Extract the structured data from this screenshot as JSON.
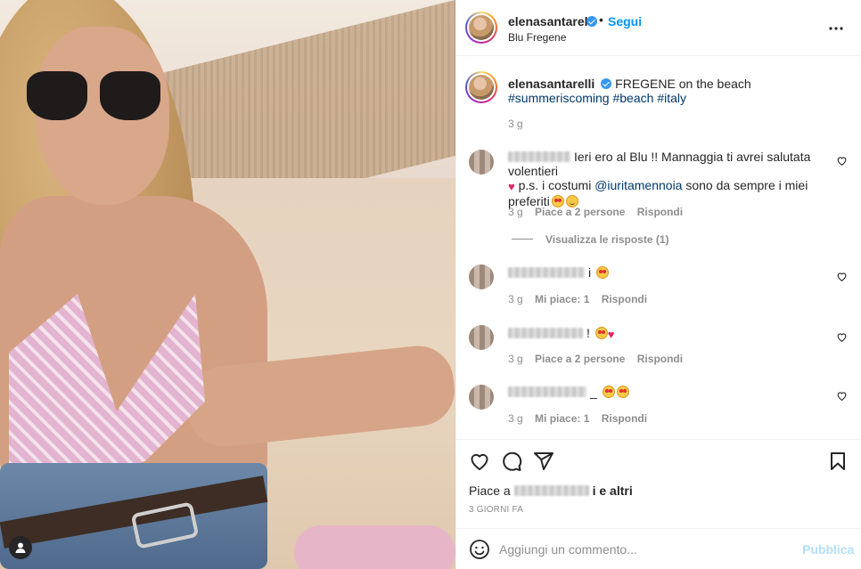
{
  "post": {
    "username": "elenasantarelli",
    "follow_label": "Segui",
    "dot": "•",
    "location": "Blu Fregene"
  },
  "caption": {
    "username": "elenasantarelli",
    "text": "FREGENE on the beach",
    "hashtags": [
      "#summeriscoming",
      "#beach",
      "#italy"
    ],
    "time": "3 g"
  },
  "comments": [
    {
      "text_a": "Ieri ero al Blu !! Mannaggia ti avrei salutata volentieri",
      "text_b": "p.s. i costumi",
      "mention": "@iuritamennoia",
      "text_c": "sono da sempre i miei preferiti",
      "time": "3 g",
      "likes": "Piace a 2 persone",
      "reply": "Rispondi"
    },
    {
      "name_suffix": "i",
      "time": "3 g",
      "likes": "Mi piace: 1",
      "reply": "Rispondi"
    },
    {
      "name_suffix": "!",
      "time": "3 g",
      "likes": "Piace a 2 persone",
      "reply": "Rispondi"
    },
    {
      "name_suffix": "_",
      "time": "3 g",
      "likes": "Mi piace: 1",
      "reply": "Rispondi"
    }
  ],
  "view_replies": "Visualizza le risposte (1)",
  "likes_line": {
    "prefix": "Piace a",
    "suffix": "e altri"
  },
  "posted_when": "3 GIORNI FA",
  "add_comment": {
    "placeholder": "Aggiungi un commento...",
    "publish": "Pubblica"
  },
  "colors": {
    "accent": "#0095f6",
    "publish_disabled": "#b2dffc",
    "heart": "#e0245e",
    "hashtag": "#00376b"
  },
  "icons": [
    "more-icon",
    "heart-icon",
    "comment-icon",
    "share-icon",
    "bookmark-icon",
    "emoji-icon",
    "user-icon",
    "verified-icon"
  ]
}
